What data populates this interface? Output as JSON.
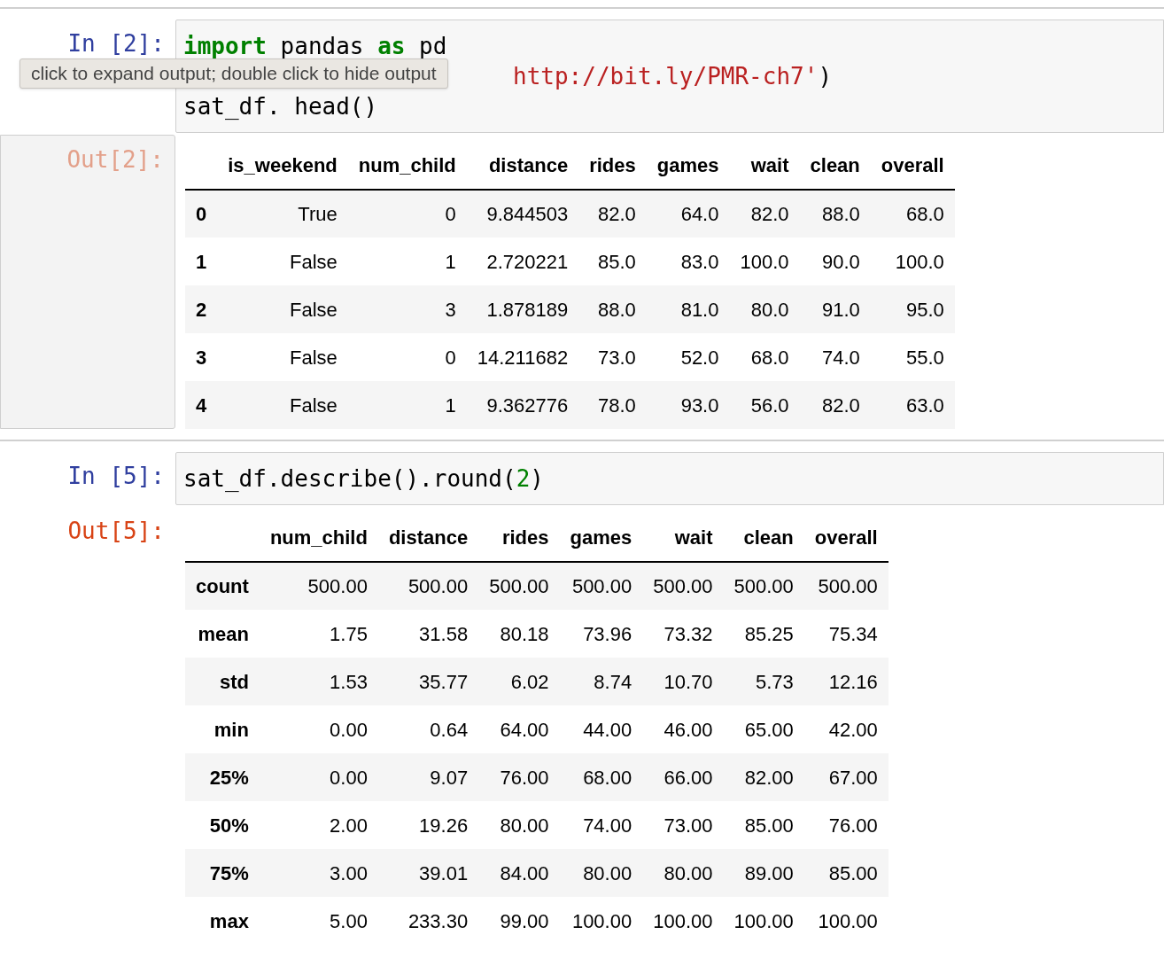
{
  "cells": [
    {
      "prompt_in": "In [2]:",
      "code": [
        [
          {
            "kind": "keyword",
            "text": "import"
          },
          {
            "kind": "plain",
            "text": " pandas "
          },
          {
            "kind": "keyword",
            "text": "as"
          },
          {
            "kind": "plain",
            "text": " pd"
          }
        ],
        [
          {
            "kind": "string",
            "text": "http://bit.ly/PMR-ch7'"
          },
          {
            "kind": "plain",
            "text": ")"
          }
        ],
        [
          {
            "kind": "plain",
            "text": "sat_df. head()"
          }
        ]
      ],
      "tooltip": "click to expand output; double click to hide output",
      "prompt_out": "Out[2]:",
      "output_selected": true,
      "table": {
        "columns": [
          "",
          "is_weekend",
          "num_child",
          "distance",
          "rides",
          "games",
          "wait",
          "clean",
          "overall"
        ],
        "rows": [
          [
            "0",
            "True",
            "0",
            "9.844503",
            "82.0",
            "64.0",
            "82.0",
            "88.0",
            "68.0"
          ],
          [
            "1",
            "False",
            "1",
            "2.720221",
            "85.0",
            "83.0",
            "100.0",
            "90.0",
            "100.0"
          ],
          [
            "2",
            "False",
            "3",
            "1.878189",
            "88.0",
            "81.0",
            "80.0",
            "91.0",
            "95.0"
          ],
          [
            "3",
            "False",
            "0",
            "14.211682",
            "73.0",
            "52.0",
            "68.0",
            "74.0",
            "55.0"
          ],
          [
            "4",
            "False",
            "1",
            "9.362776",
            "78.0",
            "93.0",
            "56.0",
            "82.0",
            "63.0"
          ]
        ]
      }
    },
    {
      "prompt_in": "In [5]:",
      "code": [
        [
          {
            "kind": "plain",
            "text": "sat_df.describe().round("
          },
          {
            "kind": "number",
            "text": "2"
          },
          {
            "kind": "plain",
            "text": ")"
          }
        ]
      ],
      "prompt_out": "Out[5]:",
      "output_selected": false,
      "table": {
        "columns": [
          "",
          "num_child",
          "distance",
          "rides",
          "games",
          "wait",
          "clean",
          "overall"
        ],
        "rows": [
          [
            "count",
            "500.00",
            "500.00",
            "500.00",
            "500.00",
            "500.00",
            "500.00",
            "500.00"
          ],
          [
            "mean",
            "1.75",
            "31.58",
            "80.18",
            "73.96",
            "73.32",
            "85.25",
            "75.34"
          ],
          [
            "std",
            "1.53",
            "35.77",
            "6.02",
            "8.74",
            "10.70",
            "5.73",
            "12.16"
          ],
          [
            "min",
            "0.00",
            "0.64",
            "64.00",
            "44.00",
            "46.00",
            "65.00",
            "42.00"
          ],
          [
            "25%",
            "0.00",
            "9.07",
            "76.00",
            "68.00",
            "66.00",
            "82.00",
            "67.00"
          ],
          [
            "50%",
            "2.00",
            "19.26",
            "80.00",
            "74.00",
            "73.00",
            "85.00",
            "76.00"
          ],
          [
            "75%",
            "3.00",
            "39.01",
            "84.00",
            "80.00",
            "80.00",
            "89.00",
            "85.00"
          ],
          [
            "max",
            "5.00",
            "233.30",
            "99.00",
            "100.00",
            "100.00",
            "100.00",
            "100.00"
          ]
        ]
      }
    }
  ]
}
